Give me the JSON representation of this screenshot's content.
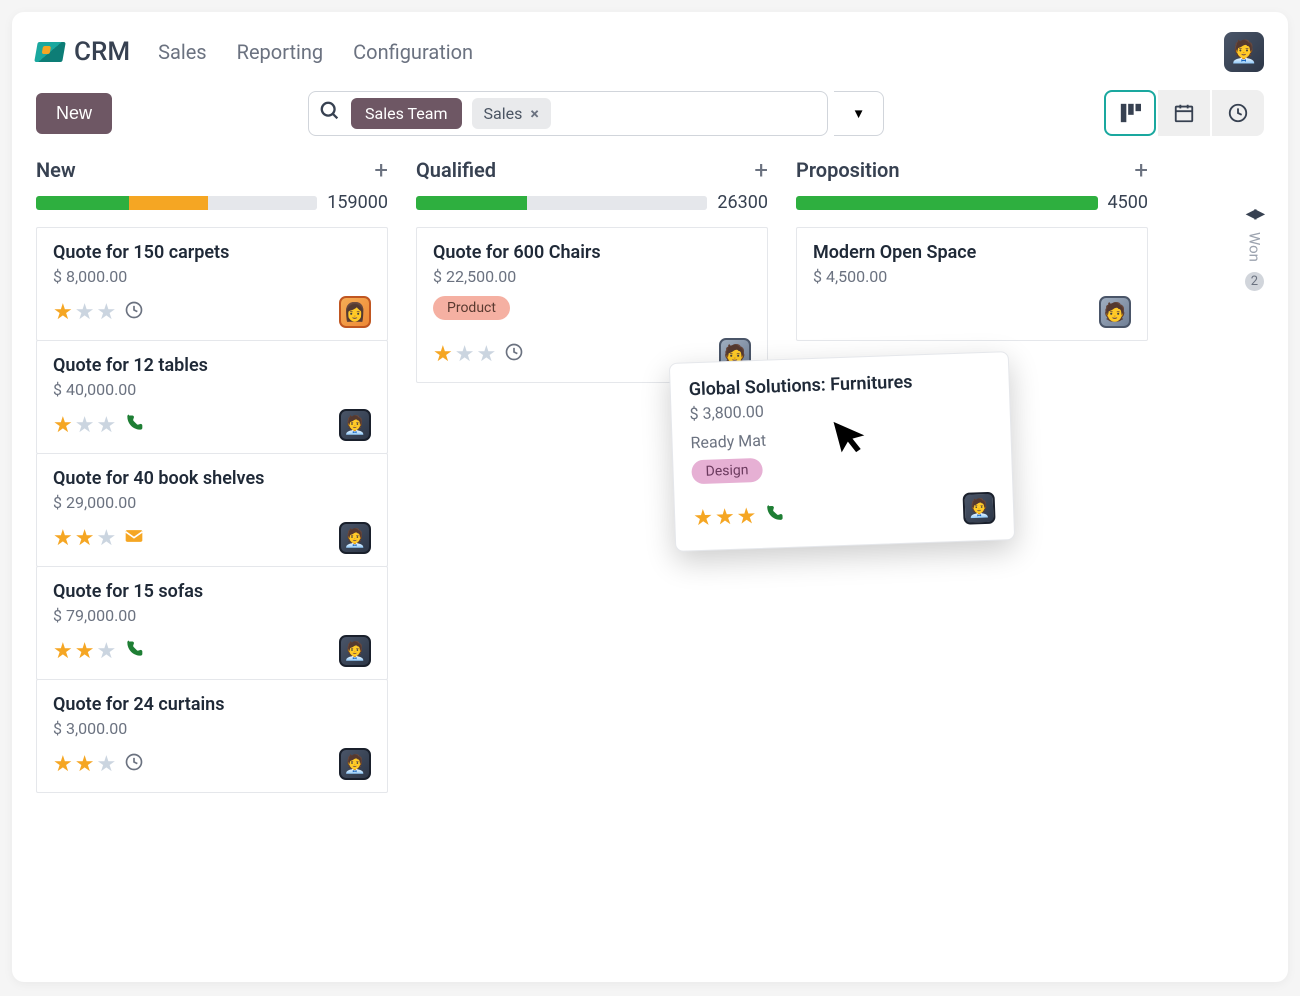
{
  "brand": "CRM",
  "nav": {
    "sales": "Sales",
    "reporting": "Reporting",
    "configuration": "Configuration"
  },
  "toolbar": {
    "new": "New"
  },
  "search": {
    "chip": "Sales Team",
    "filter": "Sales"
  },
  "side": {
    "label": "Won",
    "count": "2"
  },
  "columns": [
    {
      "title": "New",
      "total": "159000",
      "segments": [
        {
          "color": "#2eaf3f",
          "width": "33%"
        },
        {
          "color": "#f5a623",
          "width": "28%"
        },
        {
          "color": "#e5e7eb",
          "width": "39%"
        }
      ],
      "cards": [
        {
          "title": "Quote for 150 carpets",
          "amount": "$ 8,000.00",
          "stars": 1,
          "activity": "clock",
          "avatar": "av-1"
        },
        {
          "title": "Quote for 12 tables",
          "amount": "$ 40,000.00",
          "stars": 1,
          "activity": "phone",
          "avatar": "av-2"
        },
        {
          "title": "Quote for 40 book shelves",
          "amount": "$ 29,000.00",
          "stars": 2,
          "activity": "mail",
          "avatar": "av-2"
        },
        {
          "title": "Quote for 15 sofas",
          "amount": "$ 79,000.00",
          "stars": 2,
          "activity": "phone",
          "avatar": "av-2"
        },
        {
          "title": "Quote for 24 curtains",
          "amount": "$ 3,000.00",
          "stars": 2,
          "activity": "clock",
          "avatar": "av-2"
        }
      ]
    },
    {
      "title": "Qualified",
      "total": "26300",
      "segments": [
        {
          "color": "#2eaf3f",
          "width": "38%"
        },
        {
          "color": "#e5e7eb",
          "width": "62%"
        }
      ],
      "cards": [
        {
          "title": "Quote for 600 Chairs",
          "amount": "$ 22,500.00",
          "tag": "Product",
          "tagColor": "#f5b0a2",
          "stars": 1,
          "activity": "clock",
          "avatar": "av-3"
        }
      ]
    },
    {
      "title": "Proposition",
      "total": "4500",
      "segments": [
        {
          "color": "#2eaf3f",
          "width": "100%"
        }
      ],
      "cards": [
        {
          "title": "Modern Open Space",
          "amount": "$ 4,500.00",
          "stars": 0,
          "noStars": true,
          "avatar": "av-3"
        }
      ]
    }
  ],
  "floating": {
    "title": "Global Solutions: Furnitures",
    "amount": "$ 3,800.00",
    "sub": "Ready Mat",
    "tag": "Design",
    "tagColor": "#e6b0d4",
    "stars": 3,
    "activity": "phone",
    "avatar": "av-2"
  }
}
